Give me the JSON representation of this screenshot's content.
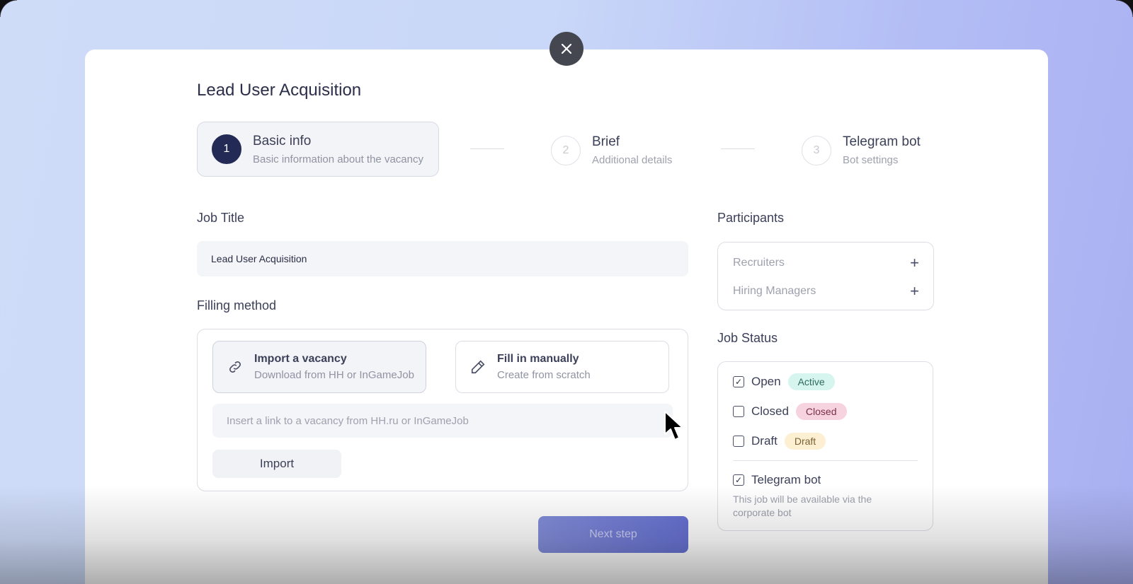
{
  "page_title": "Lead User Acquisition",
  "steps": [
    {
      "number": "1",
      "title": "Basic info",
      "subtitle": "Basic information about the vacancy"
    },
    {
      "number": "2",
      "title": "Brief",
      "subtitle": "Additional details"
    },
    {
      "number": "3",
      "title": "Telegram bot",
      "subtitle": "Bot settings"
    }
  ],
  "job_title": {
    "label": "Job Title",
    "value": "Lead User Acquisition"
  },
  "filling_method": {
    "label": "Filling method",
    "import_option": {
      "title": "Import a vacancy",
      "subtitle": "Download from HH or InGameJob"
    },
    "manual_option": {
      "title": "Fill in manually",
      "subtitle": "Create from scratch"
    },
    "link_placeholder": "Insert a link to a vacancy from HH.ru or InGameJob",
    "import_button": "Import"
  },
  "participants": {
    "label": "Participants",
    "recruiters": "Recruiters",
    "hiring_managers": "Hiring Managers"
  },
  "job_status": {
    "label": "Job Status",
    "options": [
      {
        "name": "Open",
        "badge": "Active",
        "checked": true,
        "badge_bg": "#d5f5ee",
        "badge_color": "#2f6b60"
      },
      {
        "name": "Closed",
        "badge": "Closed",
        "checked": false,
        "badge_bg": "#f7d3df",
        "badge_color": "#7a3048"
      },
      {
        "name": "Draft",
        "badge": "Draft",
        "checked": false,
        "badge_bg": "#fcefd2",
        "badge_color": "#7a6232"
      }
    ],
    "telegram": {
      "label": "Telegram bot",
      "checked": true,
      "description": "This job will be available via the corporate bot"
    }
  },
  "next_button": "Next step",
  "colors": {
    "accent": "#232a55",
    "primary_button": "#6b75d4"
  }
}
